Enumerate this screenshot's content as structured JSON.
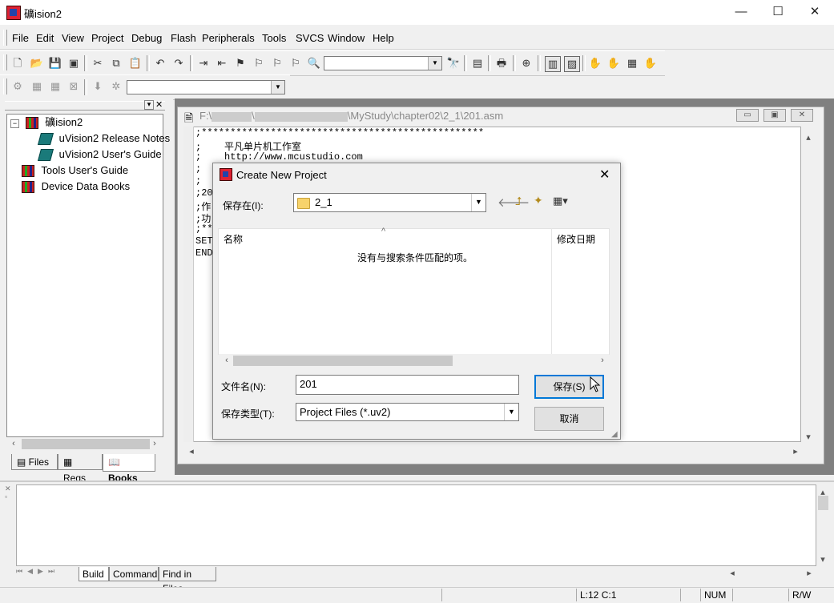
{
  "window": {
    "title": "礦ision2",
    "minimize": "—",
    "maximize": "☐",
    "close": "✕"
  },
  "menu": [
    "File",
    "Edit",
    "View",
    "Project",
    "Debug",
    "Flash",
    "Peripherals",
    "Tools",
    "SVCS",
    "Window",
    "Help"
  ],
  "toolbar1": {
    "find_combo_value": ""
  },
  "toolbar2": {
    "target_combo_value": ""
  },
  "project_panel": {
    "tree": [
      {
        "label": "礦ision2",
        "level": 0,
        "expander": "−"
      },
      {
        "label": "uVision2 Release Notes",
        "level": 1
      },
      {
        "label": "uVision2 User's Guide",
        "level": 1
      },
      {
        "label": "Tools User's Guide",
        "level": 0
      },
      {
        "label": "Device Data Books",
        "level": 0
      }
    ],
    "tabs": [
      "Files",
      "Regs",
      "Books"
    ],
    "active_tab": "Books"
  },
  "editor": {
    "path_start": "F:\\",
    "path_mid": "\\",
    "path_end": "\\MyStudy\\chapter02\\2_1\\201.asm",
    "lines": [
      ";*************************************************",
      ";    平凡单片机工作室",
      ";    http://www.mcustudio.com",
      ";",
      ";",
      ";20",
      ";作",
      ";功",
      ";**",
      "SET",
      "END"
    ]
  },
  "dialog": {
    "title": "Create New Project",
    "save_in_label": "保存在(I):",
    "save_in_value": "2_1",
    "col_name": "名称",
    "col_modified": "修改日期",
    "empty_message": "没有与搜索条件匹配的项。",
    "filename_label": "文件名(N):",
    "filename_value": "201",
    "filetype_label": "保存类型(T):",
    "filetype_value": "Project Files (*.uv2)",
    "save_button": "保存(S)",
    "cancel_button": "取消"
  },
  "output_panel": {
    "tabs": [
      "Build",
      "Command",
      "Find in Files"
    ],
    "active_tab": "Build"
  },
  "statusbar": {
    "position": "L:12 C:1",
    "num": "NUM",
    "rw": "R/W"
  }
}
